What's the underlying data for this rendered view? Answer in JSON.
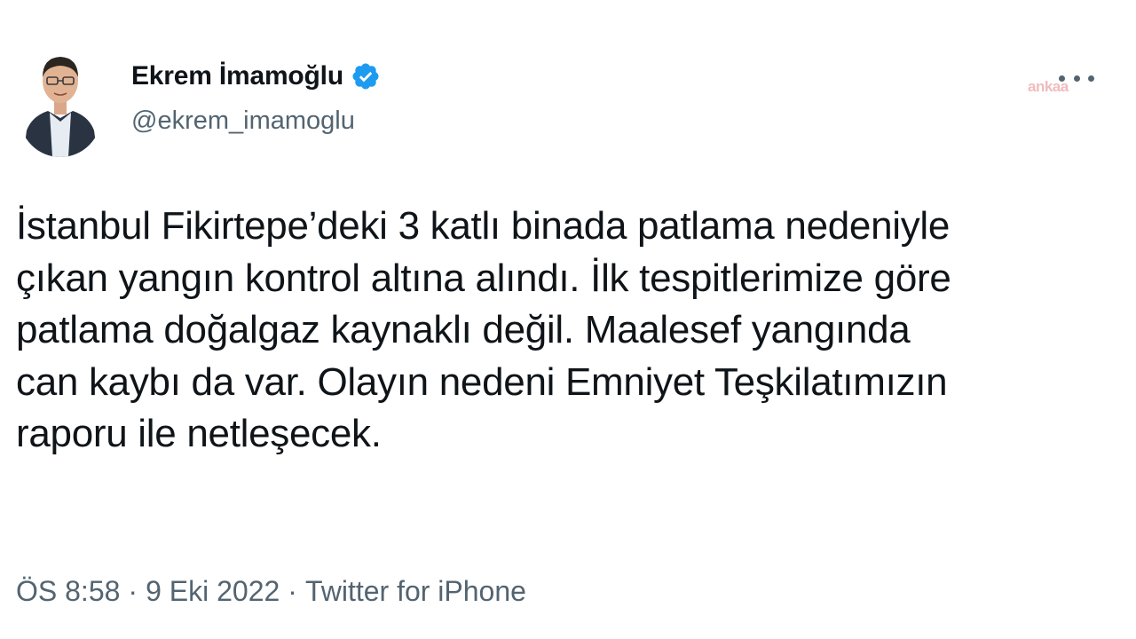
{
  "author": {
    "display_name": "Ekrem İmamoğlu",
    "handle": "@ekrem_imamoglu",
    "verified": true,
    "verified_color": "#1d9bf0"
  },
  "watermark": "ankaa",
  "tweet": {
    "text": "İstanbul Fikirtepe’deki 3 katlı binada patlama nedeniyle\nçıkan yangın kontrol altına alındı. İlk tespitlerimize göre\npatlama doğalgaz kaynaklı değil. Maalesef yangında\ncan kaybı da var. Olayın nedeni Emniyet Teşkilatımızın\nraporu ile netleşecek."
  },
  "meta": {
    "time": "ÖS 8:58",
    "separator": "·",
    "date": "9 Eki 2022",
    "source": "Twitter for iPhone"
  },
  "icons": {
    "more": "more-horizontal-icon",
    "verified": "verified-badge-icon"
  }
}
